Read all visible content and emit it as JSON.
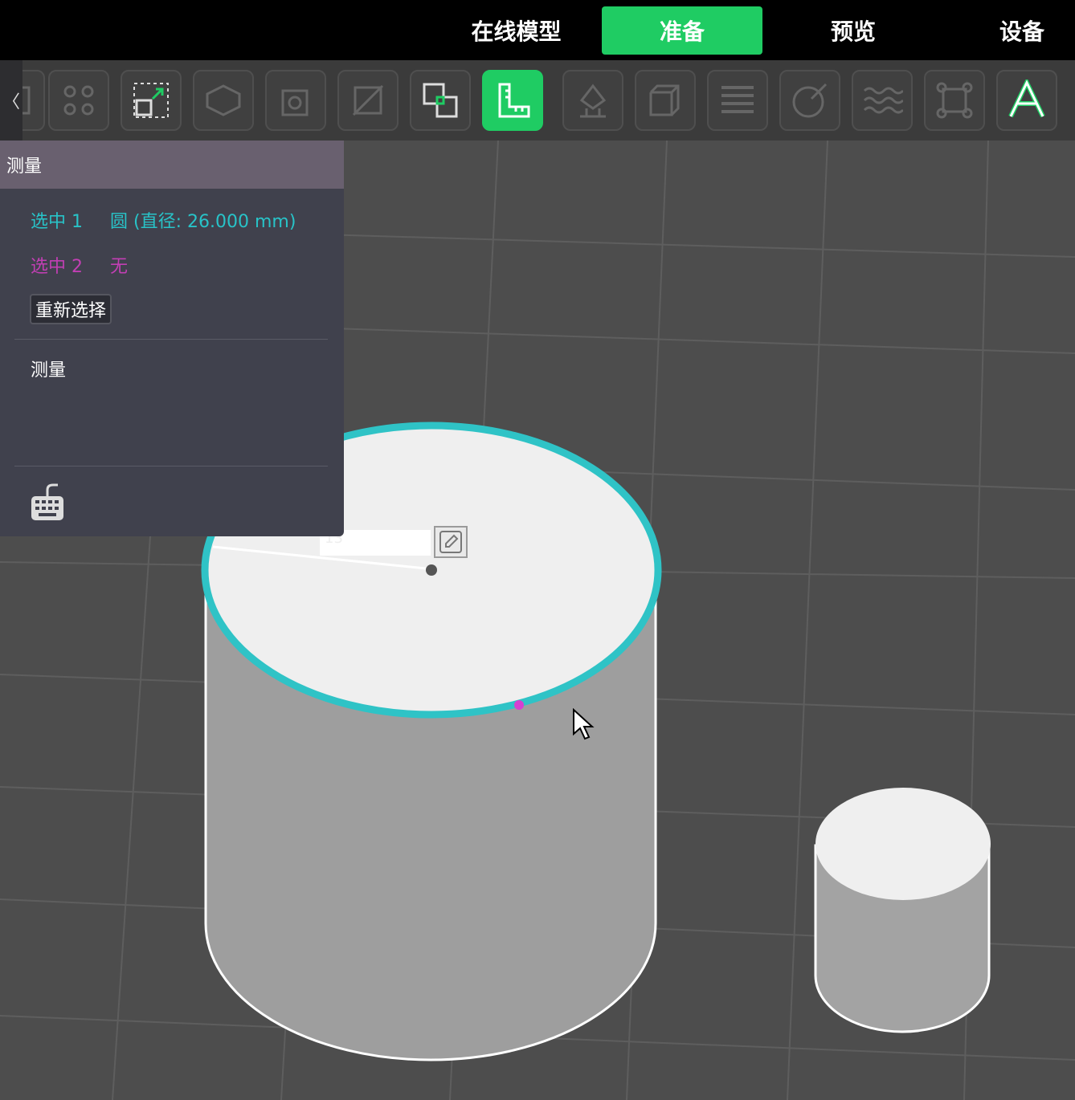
{
  "nav": {
    "tabs": [
      {
        "label": "在线模型",
        "active": false
      },
      {
        "label": "准备",
        "active": true
      },
      {
        "label": "预览",
        "active": false
      },
      {
        "label": "设备",
        "active": false
      }
    ]
  },
  "toolbar": {
    "collapse_label": "〈",
    "tools": [
      {
        "name": "arrange-icon",
        "active": false
      },
      {
        "name": "scale-icon",
        "active": false
      },
      {
        "name": "auto-orient-icon",
        "active": false
      },
      {
        "name": "hollow-icon",
        "active": false
      },
      {
        "name": "cut-icon",
        "active": false
      },
      {
        "name": "boolean-icon",
        "active": false
      },
      {
        "name": "measure-icon",
        "active": true
      },
      {
        "name": "support-icon",
        "active": false
      },
      {
        "name": "repair-icon",
        "active": false
      },
      {
        "name": "layers-icon",
        "active": false
      },
      {
        "name": "paint-icon",
        "active": false
      },
      {
        "name": "texture-icon",
        "active": false
      },
      {
        "name": "bounding-box-icon",
        "active": false
      },
      {
        "name": "text-icon",
        "active": false
      }
    ]
  },
  "panel": {
    "title": "测量",
    "selection1": {
      "label": "选中 1",
      "value": "圆 (直径: 26.000 mm)"
    },
    "selection2": {
      "label": "选中 2",
      "value": "无"
    },
    "reselect_label": "重新选择",
    "measure_label": "测量"
  },
  "dimension": {
    "value": "13"
  },
  "colors": {
    "accent": "#1fcc63",
    "selection1": "#28c3c8",
    "selection2": "#c23fb4"
  }
}
